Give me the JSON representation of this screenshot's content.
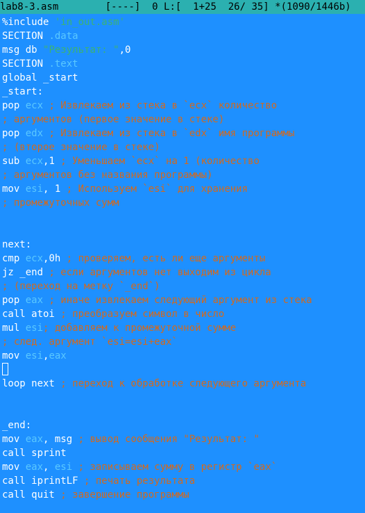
{
  "status_bar": {
    "filename": "lab8-3.asm",
    "info": "        [----]  0 L:[  1+25  26/ 35] *(1090/1446b)"
  },
  "lines": [
    [
      {
        "t": "%include ",
        "c": "kw"
      },
      {
        "t": "'in_out.asm'",
        "c": "str"
      }
    ],
    [
      {
        "t": "SECTION ",
        "c": "kw"
      },
      {
        "t": ".data",
        "c": "reg"
      }
    ],
    [
      {
        "t": "msg db ",
        "c": "kw"
      },
      {
        "t": "\"Результат: \"",
        "c": "str"
      },
      {
        "t": ",0",
        "c": "kw"
      }
    ],
    [
      {
        "t": "SECTION ",
        "c": "kw"
      },
      {
        "t": ".text",
        "c": "reg"
      }
    ],
    [
      {
        "t": "global _start",
        "c": "kw"
      }
    ],
    [
      {
        "t": "_start:",
        "c": "kw"
      }
    ],
    [
      {
        "t": "pop ",
        "c": "kw"
      },
      {
        "t": "ecx",
        "c": "reg"
      },
      {
        "t": " ; Извлекаем из стека в `ecx` количество",
        "c": "cmt"
      }
    ],
    [
      {
        "t": "; аргументов (первое значение в стеке)",
        "c": "cmt"
      }
    ],
    [
      {
        "t": "pop ",
        "c": "kw"
      },
      {
        "t": "edx",
        "c": "reg"
      },
      {
        "t": " ; Извлекаем из стека в `edx` имя программы",
        "c": "cmt"
      }
    ],
    [
      {
        "t": "; (второе значение в стеке)",
        "c": "cmt"
      }
    ],
    [
      {
        "t": "sub ",
        "c": "kw"
      },
      {
        "t": "ecx",
        "c": "reg"
      },
      {
        "t": ",1",
        "c": "kw"
      },
      {
        "t": " ; Уменьшаем `ecx` на 1 (количество",
        "c": "cmt"
      }
    ],
    [
      {
        "t": "; аргументов без названия программы)",
        "c": "cmt"
      }
    ],
    [
      {
        "t": "mov ",
        "c": "kw"
      },
      {
        "t": "esi",
        "c": "reg"
      },
      {
        "t": ", 1",
        "c": "kw"
      },
      {
        "t": " ; Используем `esi` для хранения",
        "c": "cmt"
      }
    ],
    [
      {
        "t": "; промежуточных сумм",
        "c": "cmt"
      }
    ],
    [],
    [],
    [
      {
        "t": "next:",
        "c": "kw"
      }
    ],
    [
      {
        "t": "cmp ",
        "c": "kw"
      },
      {
        "t": "ecx",
        "c": "reg"
      },
      {
        "t": ",0h",
        "c": "kw"
      },
      {
        "t": " ; проверяем, есть ли еще аргументы",
        "c": "cmt"
      }
    ],
    [
      {
        "t": "jz _end",
        "c": "kw"
      },
      {
        "t": " ; если аргументов нет выходим из цикла",
        "c": "cmt"
      }
    ],
    [
      {
        "t": "; (переход на метку `_end`)",
        "c": "cmt"
      }
    ],
    [
      {
        "t": "pop ",
        "c": "kw"
      },
      {
        "t": "eax",
        "c": "reg"
      },
      {
        "t": " ; иначе извлекаем следующий аргумент из стека",
        "c": "cmt"
      }
    ],
    [
      {
        "t": "call atoi",
        "c": "kw"
      },
      {
        "t": " ; преобразуем символ в число",
        "c": "cmt"
      }
    ],
    [
      {
        "t": "mul ",
        "c": "kw"
      },
      {
        "t": "esi",
        "c": "reg"
      },
      {
        "t": "; добавляем к промежуточной сумме",
        "c": "cmt"
      }
    ],
    [
      {
        "t": "; след. аргумент `esi=esi+eax`",
        "c": "cmt"
      }
    ],
    [
      {
        "t": "mov ",
        "c": "kw"
      },
      {
        "t": "esi",
        "c": "reg"
      },
      {
        "t": ",",
        "c": "kw"
      },
      {
        "t": "eax",
        "c": "reg"
      }
    ],
    [
      {
        "cursor": true
      }
    ],
    [
      {
        "t": "loop next",
        "c": "kw"
      },
      {
        "t": " ; переход к обработке следующего аргумента",
        "c": "cmt"
      }
    ],
    [],
    [],
    [
      {
        "t": "_end:",
        "c": "kw"
      }
    ],
    [
      {
        "t": "mov ",
        "c": "kw"
      },
      {
        "t": "eax",
        "c": "reg"
      },
      {
        "t": ", msg",
        "c": "kw"
      },
      {
        "t": " ; вывод сообщения \"Результат: \"",
        "c": "cmt"
      }
    ],
    [
      {
        "t": "call sprint",
        "c": "kw"
      }
    ],
    [
      {
        "t": "mov ",
        "c": "kw"
      },
      {
        "t": "eax",
        "c": "reg"
      },
      {
        "t": ", ",
        "c": "kw"
      },
      {
        "t": "esi",
        "c": "reg"
      },
      {
        "t": " ; записываем сумму в регистр `eax`",
        "c": "cmt"
      }
    ],
    [
      {
        "t": "call iprintLF",
        "c": "kw"
      },
      {
        "t": " ; печать результата",
        "c": "cmt"
      }
    ],
    [
      {
        "t": "call quit",
        "c": "kw"
      },
      {
        "t": " ; завершение программы",
        "c": "cmt"
      }
    ]
  ]
}
